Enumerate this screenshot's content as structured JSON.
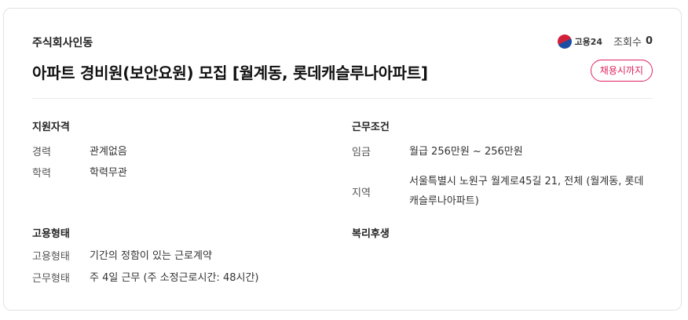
{
  "header": {
    "company": "주식회사인동",
    "source_label": "고용24",
    "views_label": "조회수",
    "views_count": "0",
    "title": "아파트 경비원(보안요원) 모집 [월계동, 롯데캐슬루나아파트]",
    "deadline_button": "채용시까지"
  },
  "sections": {
    "qualifications": {
      "title": "지원자격",
      "rows": [
        {
          "label": "경력",
          "value": "관계없음"
        },
        {
          "label": "학력",
          "value": "학력무관"
        }
      ]
    },
    "conditions": {
      "title": "근무조건",
      "rows": [
        {
          "label": "임금",
          "value": "월급 256만원 ~ 256만원"
        },
        {
          "label": "지역",
          "value_line1": "서울특별시 노원구 월계로45길 21, 전체 (월계동, 롯데",
          "value_line2": "캐슬루나아파트)"
        }
      ]
    },
    "employment": {
      "title": "고용형태",
      "rows": [
        {
          "label": "고용형태",
          "value": "기간의 정함이 있는 근로계약"
        },
        {
          "label": "근무형태",
          "value": "주 4일 근무 (주 소정근로시간: 48시간)"
        }
      ]
    },
    "benefits": {
      "title": "복리후생"
    }
  },
  "colors": {
    "accent": "#e0245e",
    "divider": "#ececec",
    "border": "#e2e2e2"
  },
  "icons": {
    "source_logo": "taegeuk-icon"
  }
}
